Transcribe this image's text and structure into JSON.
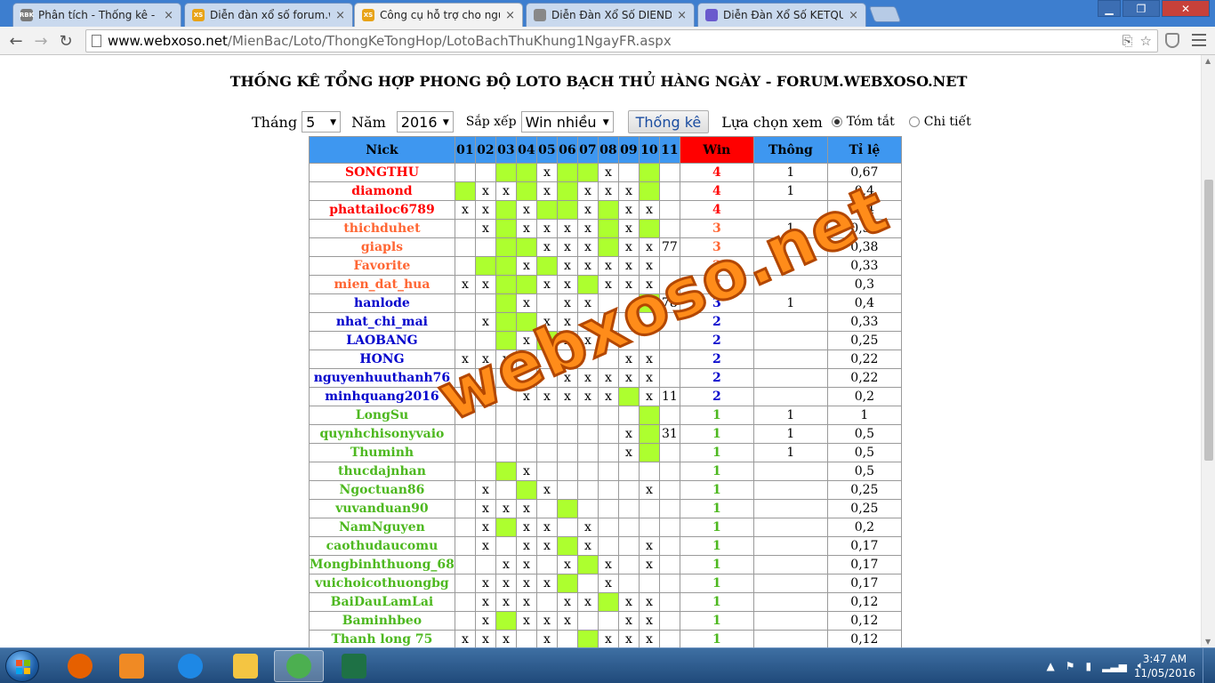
{
  "browser": {
    "tabs": [
      {
        "label": "Phân tích - Thống kê - Du",
        "favicon": "RBK",
        "color": "#7a7a7a"
      },
      {
        "label": "Diễn đàn xổ số forum.web",
        "favicon": "XS",
        "color": "#e8a317"
      },
      {
        "label": "Công cụ hỗ trợ cho người",
        "favicon": "XS",
        "color": "#e8a317"
      },
      {
        "label": "Diễn Đàn Xổ Số DIENDAN",
        "favicon": "doc",
        "color": "#888888"
      },
      {
        "label": "Diễn Đàn Xổ Số KETQUA.N",
        "favicon": "globe",
        "color": "#6a5acd"
      }
    ],
    "active_tab": 2,
    "url_host": "www.webxoso.net",
    "url_path": "/MienBac/Loto/ThongKeTongHop/LotoBachThuKhung1NgayFR.aspx"
  },
  "page": {
    "title": "THỐNG KÊ TỔNG HỢP PHONG ĐỘ LOTO BẠCH THỦ HÀNG NGÀY - FORUM.WEBXOSO.NET",
    "filters": {
      "month_label": "Tháng",
      "month_value": "5",
      "year_label": "Năm",
      "year_value": "2016",
      "sort_label": "Sắp xếp",
      "sort_value": "Win nhiều",
      "submit_label": "Thống kê",
      "view_label": "Lựa chọn xem",
      "view_options": [
        "Tóm tắt",
        "Chi tiết"
      ],
      "view_selected": 0
    }
  },
  "table": {
    "headers": [
      "Nick",
      "01",
      "02",
      "03",
      "04",
      "05",
      "06",
      "07",
      "08",
      "09",
      "10",
      "11",
      "Win",
      "Thông",
      "Tỉ lệ"
    ],
    "rows": [
      {
        "nick": "SONGTHU",
        "color": "red",
        "days": [
          "",
          "",
          "g",
          "g",
          "x",
          "g",
          "g",
          "x",
          "",
          "g",
          ""
        ],
        "win": "4",
        "thong": "1",
        "rate": "0,67"
      },
      {
        "nick": "diamond",
        "color": "red",
        "days": [
          "g",
          "x",
          "x",
          "g",
          "x",
          "g",
          "x",
          "x",
          "x",
          "g",
          ""
        ],
        "win": "4",
        "thong": "1",
        "rate": "0,4"
      },
      {
        "nick": "phattailoc6789",
        "color": "red",
        "days": [
          "x",
          "x",
          "g",
          "x",
          "g",
          "g",
          "x",
          "g",
          "x",
          "x",
          ""
        ],
        "win": "4",
        "thong": "",
        "rate": "0,4"
      },
      {
        "nick": "thichduhet",
        "color": "orange",
        "days": [
          "",
          "x",
          "g",
          "x",
          "x",
          "x",
          "x",
          "g",
          "x",
          "g",
          ""
        ],
        "win": "3",
        "thong": "1",
        "rate": "0,33"
      },
      {
        "nick": "giapls",
        "color": "orange",
        "days": [
          "",
          "",
          "g",
          "g",
          "x",
          "x",
          "x",
          "g",
          "x",
          "x",
          "77"
        ],
        "win": "3",
        "thong": "",
        "rate": "0,38"
      },
      {
        "nick": "Favorite",
        "color": "orange",
        "days": [
          "",
          "g",
          "g",
          "x",
          "g",
          "x",
          "x",
          "x",
          "x",
          "x",
          ""
        ],
        "win": "3",
        "thong": "",
        "rate": "0,33"
      },
      {
        "nick": "mien_dat_hua",
        "color": "orange",
        "days": [
          "x",
          "x",
          "g",
          "g",
          "x",
          "x",
          "g",
          "x",
          "x",
          "x",
          ""
        ],
        "win": "3",
        "thong": "",
        "rate": "0,3"
      },
      {
        "nick": "hanlode",
        "color": "blue",
        "days": [
          "",
          "",
          "g",
          "x",
          "",
          "x",
          "x",
          "",
          "",
          "g",
          "78"
        ],
        "win": "3",
        "thong": "1",
        "rate": "0,4"
      },
      {
        "nick": "nhat_chi_mai",
        "color": "blue",
        "days": [
          "",
          "x",
          "g",
          "g",
          "x",
          "x",
          "",
          "",
          "",
          "",
          ""
        ],
        "win": "2",
        "thong": "",
        "rate": "0,33"
      },
      {
        "nick": "LAOBANG",
        "color": "blue",
        "days": [
          "",
          "",
          "g",
          "x",
          "g",
          "x",
          "x",
          "",
          "",
          "",
          ""
        ],
        "win": "2",
        "thong": "",
        "rate": "0,25"
      },
      {
        "nick": "HONG",
        "color": "blue",
        "days": [
          "x",
          "x",
          "x",
          "",
          "",
          "",
          "",
          "",
          "x",
          "x",
          ""
        ],
        "win": "2",
        "thong": "",
        "rate": "0,22"
      },
      {
        "nick": "nguyenhuuthanh76",
        "color": "blue",
        "days": [
          "",
          "x",
          "",
          "",
          "",
          "x",
          "x",
          "x",
          "x",
          "x",
          ""
        ],
        "win": "2",
        "thong": "",
        "rate": "0,22"
      },
      {
        "nick": "minhquang2016",
        "color": "blue",
        "days": [
          "",
          "",
          "",
          "x",
          "x",
          "x",
          "x",
          "x",
          "g",
          "x",
          "11"
        ],
        "win": "2",
        "thong": "",
        "rate": "0,2"
      },
      {
        "nick": "LongSu",
        "color": "green",
        "days": [
          "",
          "",
          "",
          "",
          "",
          "",
          "",
          "",
          "",
          "g",
          ""
        ],
        "win": "1",
        "thong": "1",
        "rate": "1"
      },
      {
        "nick": "quynhchisonyvaio",
        "color": "green",
        "days": [
          "",
          "",
          "",
          "",
          "",
          "",
          "",
          "",
          "x",
          "g",
          "31"
        ],
        "win": "1",
        "thong": "1",
        "rate": "0,5"
      },
      {
        "nick": "Thuminh",
        "color": "green",
        "days": [
          "",
          "",
          "",
          "",
          "",
          "",
          "",
          "",
          "x",
          "g",
          ""
        ],
        "win": "1",
        "thong": "1",
        "rate": "0,5"
      },
      {
        "nick": "thucdajnhan",
        "color": "green",
        "days": [
          "",
          "",
          "g",
          "x",
          "",
          "",
          "",
          "",
          "",
          "",
          ""
        ],
        "win": "1",
        "thong": "",
        "rate": "0,5"
      },
      {
        "nick": "Ngoctuan86",
        "color": "green",
        "days": [
          "",
          "x",
          "",
          "g",
          "x",
          "",
          "",
          "",
          "",
          "x",
          ""
        ],
        "win": "1",
        "thong": "",
        "rate": "0,25"
      },
      {
        "nick": "vuvanduan90",
        "color": "green",
        "days": [
          "",
          "x",
          "x",
          "x",
          "",
          "g",
          "",
          "",
          "",
          "",
          ""
        ],
        "win": "1",
        "thong": "",
        "rate": "0,25"
      },
      {
        "nick": "NamNguyen",
        "color": "green",
        "days": [
          "",
          "x",
          "g",
          "x",
          "x",
          "",
          "x",
          "",
          "",
          "",
          ""
        ],
        "win": "1",
        "thong": "",
        "rate": "0,2"
      },
      {
        "nick": "caothudaucomu",
        "color": "green",
        "days": [
          "",
          "x",
          "",
          "x",
          "x",
          "g",
          "x",
          "",
          "",
          "x",
          ""
        ],
        "win": "1",
        "thong": "",
        "rate": "0,17"
      },
      {
        "nick": "Mongbinhthuong_68",
        "color": "green",
        "days": [
          "",
          "",
          "x",
          "x",
          "",
          "x",
          "g",
          "x",
          "",
          "x",
          ""
        ],
        "win": "1",
        "thong": "",
        "rate": "0,17"
      },
      {
        "nick": "vuichoicothuongbg",
        "color": "green",
        "days": [
          "",
          "x",
          "x",
          "x",
          "x",
          "g",
          "",
          "x",
          "",
          "",
          ""
        ],
        "win": "1",
        "thong": "",
        "rate": "0,17"
      },
      {
        "nick": "BaiDauLamLai",
        "color": "green",
        "days": [
          "",
          "x",
          "x",
          "x",
          "",
          "x",
          "x",
          "g",
          "x",
          "x",
          ""
        ],
        "win": "1",
        "thong": "",
        "rate": "0,12"
      },
      {
        "nick": "Baminhbeo",
        "color": "green",
        "days": [
          "",
          "x",
          "g",
          "x",
          "x",
          "x",
          "",
          "",
          "x",
          "x",
          ""
        ],
        "win": "1",
        "thong": "",
        "rate": "0,12"
      },
      {
        "nick": "Thanh long 75",
        "color": "green",
        "days": [
          "x",
          "x",
          "x",
          "",
          "x",
          "",
          "g",
          "x",
          "x",
          "x",
          ""
        ],
        "win": "1",
        "thong": "",
        "rate": "0,12"
      }
    ]
  },
  "watermark": "webxoso.net",
  "taskbar": {
    "apps": [
      {
        "name": "firefox-icon",
        "color": "#e66000"
      },
      {
        "name": "media-player-icon",
        "color": "#f08a24"
      },
      {
        "name": "internet-explorer-icon",
        "color": "#1e88e5"
      },
      {
        "name": "file-explorer-icon",
        "color": "#f4c542"
      },
      {
        "name": "chrome-icon",
        "color": "#4caf50"
      },
      {
        "name": "excel-icon",
        "color": "#1e7145"
      }
    ],
    "active_app": 4,
    "time": "3:47 AM",
    "date": "11/05/2016"
  }
}
